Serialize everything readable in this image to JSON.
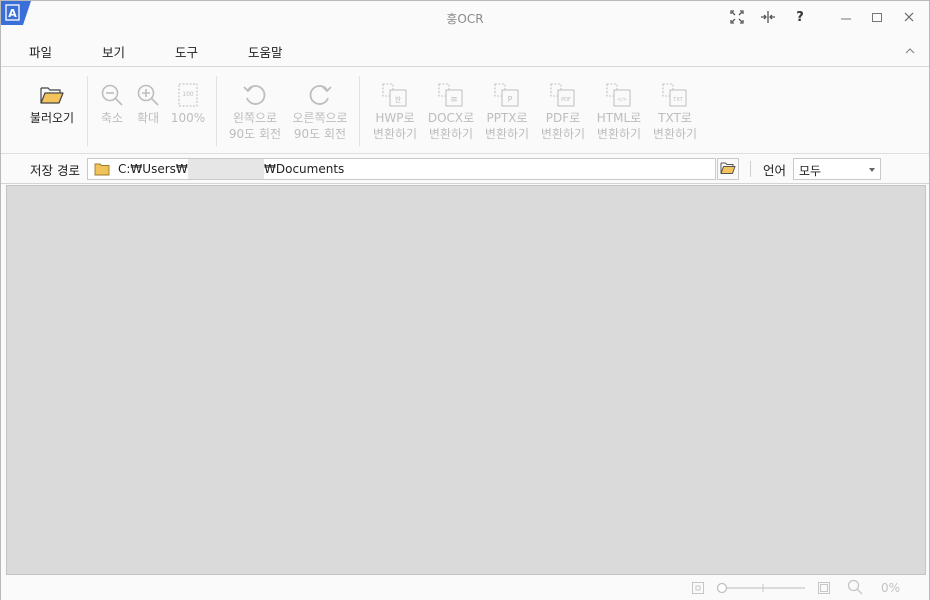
{
  "window": {
    "title": "훙OCR"
  },
  "titlebar": {
    "badge_icon": "app-logo-icon",
    "buttons": [
      "fullscreen-icon",
      "fit-width-icon",
      "help-icon",
      "minimize-icon",
      "maximize-icon",
      "close-icon"
    ],
    "help_label": "?"
  },
  "menu": {
    "items": [
      {
        "label": "파일"
      },
      {
        "label": "보기"
      },
      {
        "label": "도구"
      },
      {
        "label": "도움말"
      }
    ]
  },
  "toolbar": {
    "open": {
      "label": "불러오기"
    },
    "zoom_out": {
      "label": "축소"
    },
    "zoom_in": {
      "label": "확대"
    },
    "actual_size": {
      "label": "100%",
      "icon_text": "100"
    },
    "rotate_left": {
      "line1": "왼쪽으로",
      "line2": "90도 회전"
    },
    "rotate_right": {
      "line1": "오른쪽으로",
      "line2": "90도 회전"
    },
    "convert": [
      {
        "line1": "HWP로",
        "line2": "변환하기",
        "icon_text": "한"
      },
      {
        "line1": "DOCX로",
        "line2": "변환하기",
        "icon_text": "≡"
      },
      {
        "line1": "PPTX로",
        "line2": "변환하기",
        "icon_text": "P"
      },
      {
        "line1": "PDF로",
        "line2": "변환하기",
        "icon_text": "PDF"
      },
      {
        "line1": "HTML로",
        "line2": "변환하기",
        "icon_text": "</>"
      },
      {
        "line1": "TXT로",
        "line2": "변환하기",
        "icon_text": "TXT"
      }
    ]
  },
  "path_row": {
    "label": "저장 경로",
    "path_prefix": "C:₩Users₩",
    "path_suffix": "₩Documents",
    "language_label": "언어",
    "language_value": "모두"
  },
  "status_bar": {
    "zoom_percent": "0%"
  },
  "colors": {
    "accent": "#3a6fd8",
    "disabled_text": "#bdbdbd",
    "canvas": "#dadada"
  }
}
